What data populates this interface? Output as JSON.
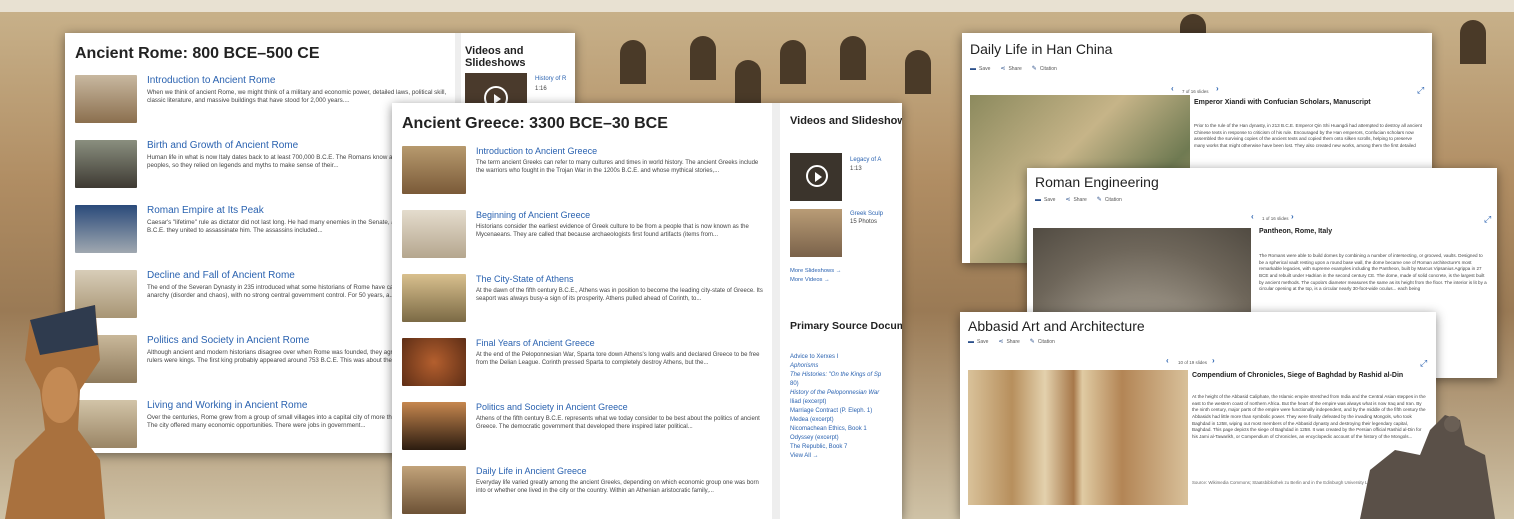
{
  "rome": {
    "title": "Ancient Rome: 800 BCE–500 CE",
    "side_title": "Videos and Slideshows",
    "video_title": "History of R",
    "video_duration": "1:16",
    "items": [
      {
        "title": "Introduction to Ancient Rome",
        "desc": "When we think of ancient Rome, we might think of a military and economic power, detailed laws, political skill, classic literature, and massive buildings that have stood for 2,000 years...."
      },
      {
        "title": "Birth and Growth of Ancient Rome",
        "desc": "Human life in what is now Italy dates back to at least 700,000 B.C.E. The Romans know about these very early peoples, so they relied on legends and myths to make sense of their..."
      },
      {
        "title": "Roman Empire at Its Peak",
        "desc": "Caesar's \"lifetime\" rule as dictator did not last long. He had many enemies in the Senate, and in March 44 B.C.E. they united to assassinate him. The assassins included..."
      },
      {
        "title": "Decline and Fall of Ancient Rome",
        "desc": "The end of the Severan Dynasty in 235 introduced what some historians of Rome have called a period of anarchy (disorder and chaos), with no strong central government control. For 50 years, a..."
      },
      {
        "title": "Politics and Society in Ancient Rome",
        "desc": "Although ancient and modern historians disagree over when Rome was founded, they agree that the first rulers were kings. The first king probably appeared around 753 B.C.E. This was about the..."
      },
      {
        "title": "Living and Working in Ancient Rome",
        "desc": "Over the centuries, Rome grew from a group of small villages into a capital city of more than 1 million people. The city offered many economic opportunities. There were jobs in government..."
      }
    ]
  },
  "greece": {
    "title": "Ancient Greece: 3300 BCE–30 BCE",
    "side_title": "Videos and Slideshows",
    "video1_title": "Legacy of A",
    "video1_duration": "1:13",
    "video2_title": "Greek Sculp",
    "video2_count": "15 Photos",
    "more_slideshows": "More Slideshows →",
    "more_videos": "More Videos →",
    "sources_title": "Primary Source Documents",
    "sources": [
      "Advice to Xerxes I",
      "Aphorisms",
      "The Histories: \"On the Kings of Sp",
      "80)",
      "History of the Peloponnesian War",
      "Iliad (excerpt)",
      "Marriage Contract (P. Eleph. 1)",
      "Medea (excerpt)",
      "Nicomachean Ethics, Book 1",
      "Odyssey (excerpt)",
      "The Republic, Book 7"
    ],
    "view_all": "View All →",
    "items": [
      {
        "title": "Introduction to Ancient Greece",
        "desc": "The term ancient Greeks can refer to many cultures and times in world history. The ancient Greeks include the warriors who fought in the Trojan War in the 1200s B.C.E. and whose mythical stories,..."
      },
      {
        "title": "Beginning of Ancient Greece",
        "desc": "Historians consider the earliest evidence of Greek culture to be from a people that is now known as the Mycenaeans. They are called that because archaeologists first found artifacts (items from..."
      },
      {
        "title": "The City-State of Athens",
        "desc": "At the dawn of the fifth century B.C.E., Athens was in position to become the leading city-state of Greece. Its seaport was always busy-a sign of its prosperity. Athens pulled ahead of Corinth, to..."
      },
      {
        "title": "Final Years of Ancient Greece",
        "desc": "At the end of the Peloponnesian War, Sparta tore down Athens's long walls and declared Greece to be free from the Delian League. Corinth pressed Sparta to completely destroy Athens, but the..."
      },
      {
        "title": "Politics and Society in Ancient Greece",
        "desc": "Athens of the fifth century B.C.E. represents what we today consider to be best about the politics of ancient Greece. The democratic government that developed there inspired later political..."
      },
      {
        "title": "Daily Life in Ancient Greece",
        "desc": "Everyday life varied greatly among the ancient Greeks, depending on which economic group one was born into or whether one lived in the city or the country. Within an Athenian aristocratic family,..."
      }
    ]
  },
  "toolbar": {
    "save": "Save",
    "share": "Share",
    "citation": "Citation"
  },
  "han": {
    "title": "Daily Life in Han China",
    "counter": "7 of 16 slides",
    "caption_title": "Emperor Xiandi with Confucian Scholars, Manuscript",
    "caption_text": "Prior to the rule of the Han dynasty, in 213 B.C.E. Emperor Qin Shi Huangdi had attempted to destroy all ancient Chinese texts in response to criticism of his rule. Encouraged by the Han emperors, Confucian scholars now assembled the surviving copies of the ancient texts and copied them onto silken scrolls, helping to preserve many works that might otherwise have been lost. They also created new works, among them the first detailed"
  },
  "eng": {
    "title": "Roman Engineering",
    "counter": "1 of 16 slides",
    "caption_title": "Pantheon, Rome, Italy",
    "caption_text": "The Romans were able to build domes by combining a number of intersecting, or grooved, vaults. Designed to be a spherical vault resting upon a round base wall, the dome became one of Roman architecture's most remarkable legacies, with supreme examples including the Pantheon, built by Marcus Vipsanius Agrippa in 27 BCE and rebuilt under Hadrian in the second century CE. The dome, made of solid concrete, is the largest built by ancient methods. The cupola's diameter measures the same as its height from the floor. The interior is lit by a circular opening at the top, is a circular nearly 30-foot-wide oculus... each being"
  },
  "abbasid": {
    "title": "Abbasid Art and Architecture",
    "counter": "10 of 19 slides",
    "caption_title": "Compendium of Chronicles, Siege of Baghdad by Rashid al-Din",
    "caption_text": "At the height of the Abbasid Caliphate, the Islamic empire stretched from India and the Central Asian steppes in the east to the western coast of northern Africa. But the heart of the empire was always what is now Iraq and Iran. By the ninth century, major parts of the empire were functionally independent, and by the middle of the fifth century the Abbasids had little more than symbolic power. They were finally defeated by the invading Mongols, who took Baghdad in 1258, wiping out most members of the Abbasid dynasty and destroying their legendary capital, Baghdad. This page depicts the siege of Baghdad in 1258. It was created by the Persian official Rashid al-Din for his Jami al-Tawarikh, or Compendium of Chronicles, an encyclopedic account of the history of the Mongols...",
    "source": "Source: Wikimedia Commons; Staatsbibliothek zu Berlin and in the Edinburgh University Library and BnF."
  },
  "colors": {
    "link": "#2a62b0",
    "icon": "#2a4f8a"
  }
}
